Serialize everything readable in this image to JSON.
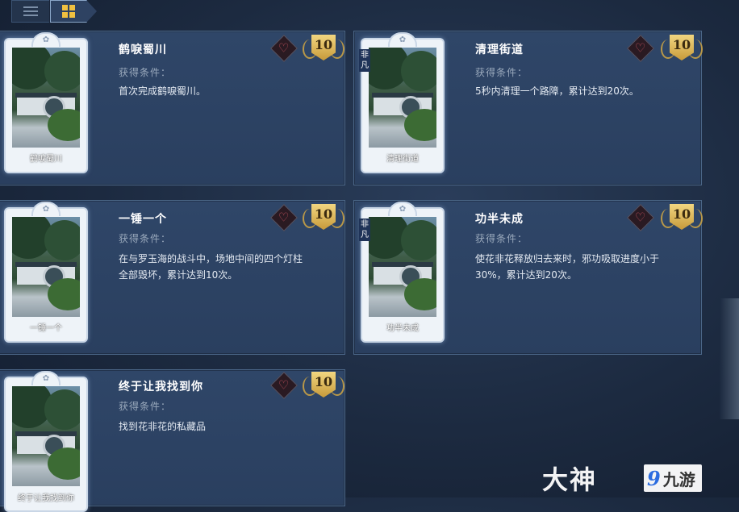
{
  "view_toggle": {
    "list_icon": "list-icon",
    "grid_icon": "grid-icon",
    "active": "grid"
  },
  "cards": [
    {
      "tag": "",
      "thumb_name": "鹤唳蜀川",
      "title": "鹤唳蜀川",
      "condition_label": "获得条件：",
      "description": "首次完成鹤唳蜀川。",
      "points": "10"
    },
    {
      "tag": "非凡",
      "thumb_name": "清理街道",
      "title": "清理街道",
      "condition_label": "获得条件：",
      "description": "5秒内清理一个路障，累计达到20次。",
      "points": "10"
    },
    {
      "tag": "",
      "thumb_name": "一锤一个",
      "title": "一锤一个",
      "condition_label": "获得条件：",
      "description": "在与罗玉海的战斗中，场地中间的四个灯柱全部毁坏，累计达到10次。",
      "points": "10"
    },
    {
      "tag": "非凡",
      "thumb_name": "功半未成",
      "title": "功半未成",
      "condition_label": "获得条件：",
      "description": "使花非花释放归去来时，邪功吸取进度小于30%，累计达到20次。",
      "points": "10"
    },
    {
      "tag": "",
      "thumb_name": "终于让我找到你",
      "title": "终于让我找到你",
      "condition_label": "获得条件：",
      "description": "找到花非花的私藏品",
      "points": "10"
    }
  ],
  "watermark": {
    "left_text": "大神",
    "logo_text": "9",
    "right_text": "九游"
  }
}
